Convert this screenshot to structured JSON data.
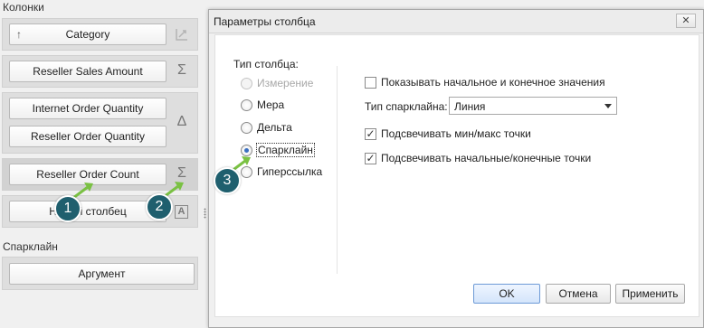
{
  "left_panel": {
    "columns_title": "Колонки",
    "items": [
      {
        "label": "Category",
        "arrow": "↑",
        "side_icon": "chart-axis-icon"
      },
      {
        "label": "Reseller Sales Amount",
        "side_icon": "sigma-icon"
      },
      {
        "label": "Internet Order Quantity",
        "side_icon": "delta-icon"
      },
      {
        "label": "Reseller Order Quantity"
      },
      {
        "label": "Reseller Order Count",
        "side_icon": "sigma-icon"
      },
      {
        "label": "Новый столбец",
        "side_icon": "text-a-icon"
      }
    ],
    "sparkline_title": "Спарклайн",
    "argument_label": "Аргумент",
    "sigma": "Σ",
    "delta": "Δ",
    "text_a": "A"
  },
  "dialog": {
    "title": "Параметры столбца",
    "close": "✕",
    "column_type_label": "Тип столбца:",
    "column_types": [
      {
        "label": "Измерение",
        "enabled": false,
        "checked": false
      },
      {
        "label": "Мера",
        "enabled": true,
        "checked": false
      },
      {
        "label": "Дельта",
        "enabled": true,
        "checked": false
      },
      {
        "label": "Спарклайн",
        "enabled": true,
        "checked": true
      },
      {
        "label": "Гиперссылка",
        "enabled": true,
        "checked": false
      }
    ],
    "show_start_end": {
      "label": "Показывать начальное и конечное значения",
      "checked": false
    },
    "sparkline_type_label": "Тип спарклайна:",
    "sparkline_type_value": "Линия",
    "highlight_minmax": {
      "label": "Подсвечивать мин/макс точки",
      "checked": true
    },
    "highlight_start_end": {
      "label": "Подсвечивать начальные/конечные точки",
      "checked": true
    },
    "buttons": {
      "ok": "OK",
      "cancel": "Отмена",
      "apply": "Применить"
    }
  },
  "callouts": [
    "1",
    "2",
    "3"
  ],
  "colors": {
    "callout": "#1f5f6e",
    "callout_arrow": "#7ac143",
    "radio_dot": "#3a6fc0"
  }
}
